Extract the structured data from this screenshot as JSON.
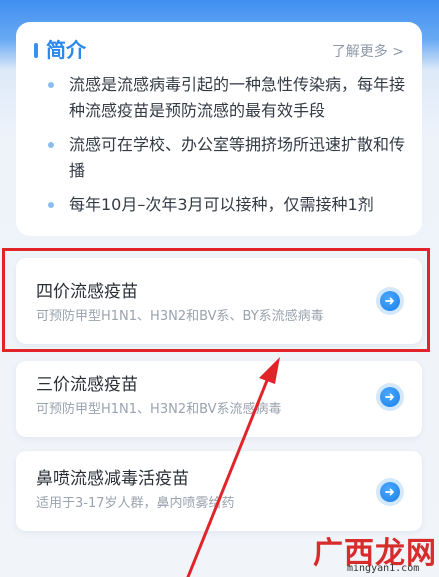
{
  "intro": {
    "title": "简介",
    "more_label": "了解更多 >",
    "bullets": [
      "流感是流感病毒引起的一种急性传染病，每年接种流感疫苗是预防流感的最有效手段",
      "流感可在学校、办公室等拥挤场所迅速扩散和传播",
      "每年10月–次年3月可以接种，仅需接种1剂"
    ]
  },
  "vaccines": [
    {
      "name": "四价流感疫苗",
      "desc": "可预防甲型H1N1、H3N2和BV系、BY系流感病毒"
    },
    {
      "name": "三价流感疫苗",
      "desc": "可预防甲型H1N1、H3N2和BV系流感病毒"
    },
    {
      "name": "鼻喷流感减毒活疫苗",
      "desc": "适用于3-17岁人群，鼻内喷雾给药"
    }
  ],
  "annotation": {
    "color": "#e0242a"
  },
  "watermark": {
    "brand": "广西龙网",
    "url": "mingyan1.com"
  },
  "colors": {
    "accent": "#2b89ee",
    "highlight": "#e0242a"
  }
}
